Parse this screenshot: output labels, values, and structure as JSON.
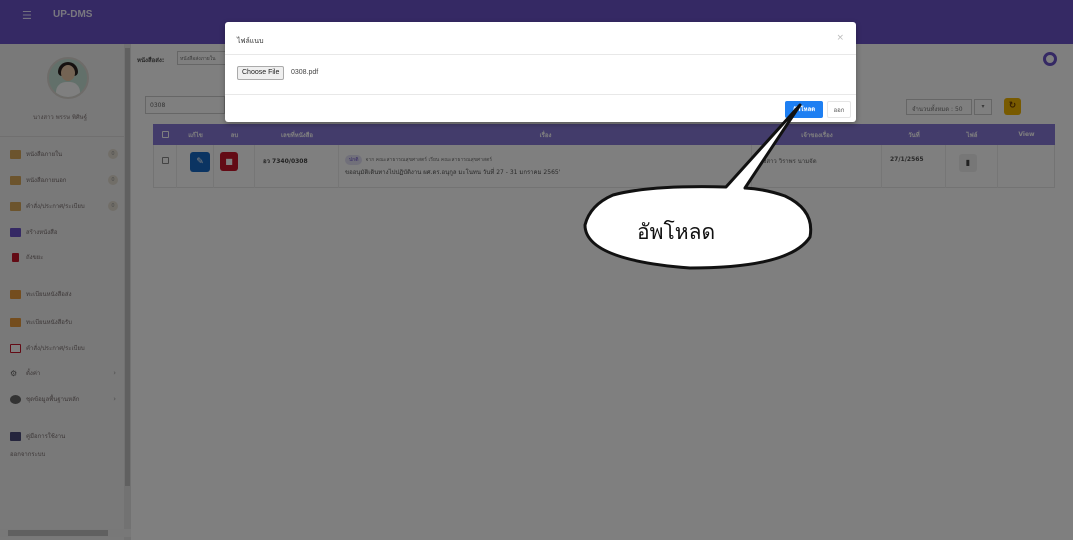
{
  "app": {
    "brand": "UP-DMS",
    "menu_icon": "hamburger-icon"
  },
  "sidebar": {
    "username": "นางสาว พรรษ พิศิษฐ์",
    "items": [
      {
        "label": "หนังสือภายใน",
        "badge": "0",
        "color": "#d9a85a"
      },
      {
        "label": "หนังสือภายนอก",
        "badge": "0",
        "color": "#d9a85a"
      },
      {
        "label": "คำสั่ง/ประกาศ/ระเบียบ",
        "badge": "0",
        "color": "#d9a85a"
      },
      {
        "label": "สร้างหนังสือ",
        "badge": "",
        "color": "#6a52c9"
      },
      {
        "label": "ถังขยะ",
        "badge": "",
        "color": "#c7172a"
      },
      {
        "label": "ทะเบียนหนังสือส่ง",
        "badge": "",
        "color": "#e89a3c"
      },
      {
        "label": "ทะเบียนหนังสือรับ",
        "badge": "",
        "color": "#e89a3c"
      },
      {
        "label": "คำสั่ง/ประกาศ/ระเบียบ",
        "badge": "",
        "color": "#c7172a"
      },
      {
        "label": "ตั้งค่า",
        "badge": "",
        "color": "#666666"
      },
      {
        "label": "ชุดข้อมูลพื้นฐานหลัก",
        "badge": "",
        "color": "#666666"
      },
      {
        "label": "คู่มือการใช้งาน",
        "badge": "",
        "color": "#4a4a7a"
      }
    ],
    "logout": "ออกจากระบบ"
  },
  "main": {
    "filter_label": "หนังสือส่ง:",
    "filter_value": "หนังสือส่งภายใน",
    "search_value": "0308",
    "perpage": "จำนวนทั้งหมด : 50",
    "table": {
      "headers": [
        "แก้ไข",
        "ลบ",
        "เลขที่หนังสือ",
        "เรื่อง",
        "เจ้าของเรื่อง",
        "วันที่",
        "ไฟล์",
        "View"
      ],
      "rows": [
        {
          "doc_no": "อว 7340/0308",
          "tag": "ปกติ",
          "from": "จาก คณะสาธารณสุขศาสตร์ เรียน คณะสาธารณสุขศาสตร์",
          "subject": "ขออนุมัติเดินทางไปปฏิบัติงาน ผศ.ดร.อนุกูล มะโนทน วันที่ 27 - 31 มกราคม 2565'",
          "owner": "นางสาว วิราพร นามจัด",
          "date": "27/1/2565"
        }
      ]
    }
  },
  "modal": {
    "title": "ไฟล์แนบ",
    "choose_label": "Choose File",
    "file_name": "0308.pdf",
    "upload_label": "อัพโหลด",
    "exit_label": "ออก"
  },
  "callout": {
    "text": "อัพโหลด"
  }
}
